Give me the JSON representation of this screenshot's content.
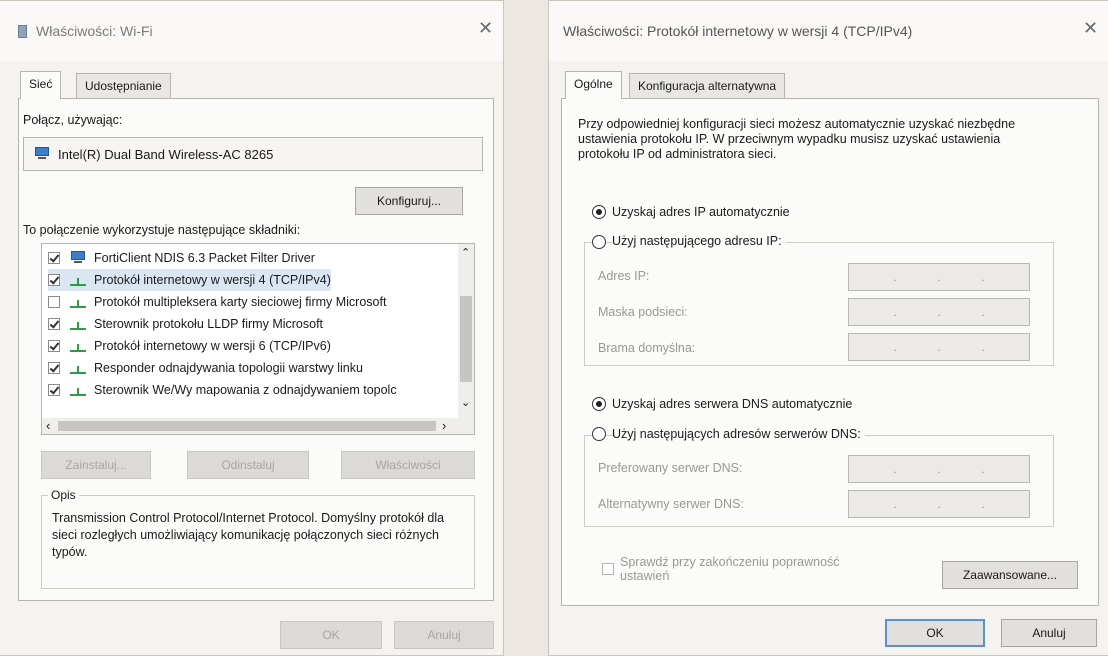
{
  "left_window": {
    "title": "Właściwości: Wi-Fi",
    "close": "✕",
    "tabs": [
      "Sieć",
      "Udostępnianie"
    ],
    "connect_using_label": "Połącz, używając:",
    "adapter_name": "Intel(R) Dual Band Wireless-AC 8265",
    "configure_button": "Konfiguruj...",
    "components_label": "To połączenie wykorzystuje następujące składniki:",
    "components": [
      {
        "checked": true,
        "icon": "computer-icon",
        "label": "FortiClient NDIS 6.3 Packet Filter Driver"
      },
      {
        "checked": true,
        "icon": "network-protocol-icon",
        "label": "Protokół internetowy w wersji 4 (TCP/IPv4)"
      },
      {
        "checked": false,
        "icon": "network-protocol-icon",
        "label": "Protokół multipleksera karty sieciowej firmy Microsoft"
      },
      {
        "checked": true,
        "icon": "network-protocol-icon",
        "label": "Sterownik protokołu LLDP firmy Microsoft"
      },
      {
        "checked": true,
        "icon": "network-protocol-icon",
        "label": "Protokół internetowy w wersji 6 (TCP/IPv6)"
      },
      {
        "checked": true,
        "icon": "network-protocol-icon",
        "label": "Responder odnajdywania topologii warstwy linku"
      },
      {
        "checked": true,
        "icon": "network-protocol-icon",
        "label": "Sterownik We/Wy mapowania z odnajdywaniem topolc"
      }
    ],
    "install_button": "Zainstaluj...",
    "uninstall_button": "Odinstaluj",
    "properties_button": "Właściwości",
    "description_heading": "Opis",
    "description_text": "Transmission Control Protocol/Internet Protocol. Domyślny protokół dla sieci rozległych umożliwiający komunikację połączonych sieci różnych typów.",
    "ok_button": "OK",
    "cancel_button": "Anuluj"
  },
  "right_window": {
    "title": "Właściwości: Protokół internetowy w wersji 4 (TCP/IPv4)",
    "close": "✕",
    "tabs": [
      "Ogólne",
      "Konfiguracja alternatywna"
    ],
    "intro": "Przy odpowiedniej konfiguracji sieci możesz automatycznie uzyskać niezbędne ustawienia protokołu IP. W przeciwnym wypadku musisz uzyskać ustawienia protokołu IP od administratora sieci.",
    "ip_auto_label": "Uzyskaj adres IP automatycznie",
    "ip_manual_label": "Użyj następującego adresu IP:",
    "ip_address_label": "Adres IP:",
    "subnet_label": "Maska podsieci:",
    "gateway_label": "Brama domyślna:",
    "dns_auto_label": "Uzyskaj adres serwera DNS automatycznie",
    "dns_manual_label": "Użyj następujących adresów serwerów DNS:",
    "preferred_dns_label": "Preferowany serwer DNS:",
    "alternate_dns_label": "Alternatywny serwer DNS:",
    "ip_dots": ".",
    "validate_label_line1": "Sprawdź przy zakończeniu poprawność",
    "validate_label_line2": "ustawień",
    "advanced_button": "Zaawansowane...",
    "ok_button": "OK",
    "cancel_button": "Anuluj"
  },
  "scroll": {
    "up": "⌃",
    "down": "⌄",
    "left": "‹",
    "right": "›"
  }
}
